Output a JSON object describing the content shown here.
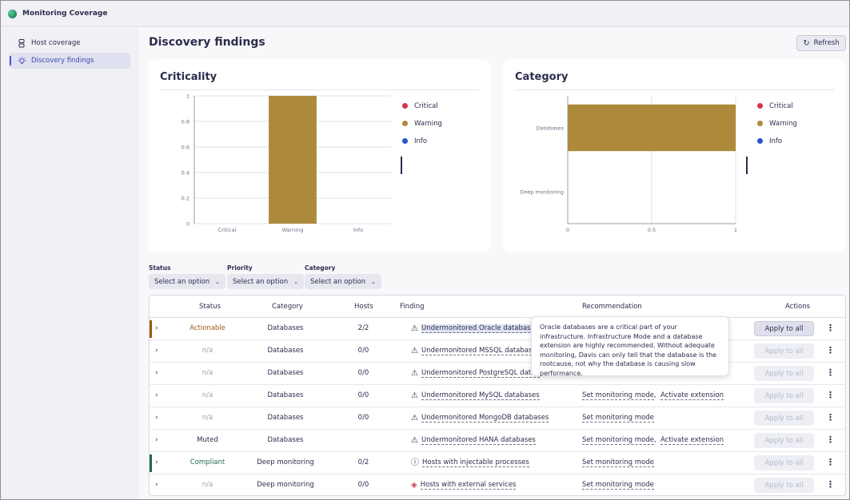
{
  "app": {
    "title": "Monitoring Coverage"
  },
  "sidebar": {
    "items": [
      {
        "label": "Host coverage",
        "icon": "server-icon"
      },
      {
        "label": "Discovery findings",
        "icon": "lightbulb-icon"
      }
    ]
  },
  "page": {
    "title": "Discovery findings",
    "refresh_label": "Refresh"
  },
  "colors": {
    "critical": "#d6324a",
    "warning": "#ad8a3b",
    "info": "#2c55c8",
    "accent": "#4556d4"
  },
  "criticality_card": {
    "title": "Criticality",
    "legend": [
      "Critical",
      "Warning",
      "Info"
    ]
  },
  "category_card": {
    "title": "Category",
    "legend": [
      "Critical",
      "Warning",
      "Info"
    ]
  },
  "chart_data": [
    {
      "type": "bar",
      "title": "Criticality",
      "categories": [
        "Critical",
        "Warning",
        "Info"
      ],
      "values": [
        0,
        1,
        0
      ],
      "ylim": [
        0,
        1
      ],
      "yticks": [
        "0",
        "0.2",
        "0.4",
        "0.6",
        "0.8",
        "1"
      ],
      "legend": [
        "Critical",
        "Warning",
        "Info"
      ],
      "legend_position": "right"
    },
    {
      "type": "bar",
      "orientation": "horizontal",
      "title": "Category",
      "categories": [
        "Databases",
        "Deep monitoring"
      ],
      "values": [
        1,
        0
      ],
      "xlim": [
        0,
        1
      ],
      "xticks": [
        "0",
        "0.5",
        "1"
      ],
      "legend": [
        "Critical",
        "Warning",
        "Info"
      ],
      "legend_position": "right"
    }
  ],
  "filters": [
    {
      "label": "Status",
      "value": "Select an option"
    },
    {
      "label": "Priority",
      "value": "Select an option"
    },
    {
      "label": "Category",
      "value": "Select an option"
    }
  ],
  "table": {
    "headers": {
      "status": "Status",
      "category": "Category",
      "hosts": "Hosts",
      "finding": "Finding",
      "recommendation": "Recommendation",
      "actions": "Actions"
    },
    "apply_label": "Apply to all",
    "rows": [
      {
        "status": "Actionable",
        "category": "Databases",
        "hosts": "2/2",
        "finding": "Undermonitored Oracle databases",
        "rec1": "",
        "rec2": ""
      },
      {
        "status": "n/a",
        "category": "Databases",
        "hosts": "0/0",
        "finding": "Undermonitored MSSQL databases",
        "rec1": "",
        "rec2": ""
      },
      {
        "status": "n/a",
        "category": "Databases",
        "hosts": "0/0",
        "finding": "Undermonitored PostgreSQL datab",
        "rec1": "",
        "rec2": ""
      },
      {
        "status": "n/a",
        "category": "Databases",
        "hosts": "0/0",
        "finding": "Undermonitored MySQL databases",
        "rec1": "Set monitoring mode",
        "rec2": "Activate extension"
      },
      {
        "status": "n/a",
        "category": "Databases",
        "hosts": "0/0",
        "finding": "Undermonitored MongoDB databases",
        "rec1": "Set monitoring mode",
        "rec2": ""
      },
      {
        "status": "Muted",
        "category": "Databases",
        "hosts": "",
        "finding": "Undermonitored HANA databases",
        "rec1": "Set monitoring mode",
        "rec2": "Activate extension"
      },
      {
        "status": "Compliant",
        "category": "Deep monitoring",
        "hosts": "0/2",
        "finding": "Hosts with injectable processes",
        "rec1": "Set monitoring mode",
        "rec2": ""
      },
      {
        "status": "n/a",
        "category": "Deep monitoring",
        "hosts": "0/0",
        "finding": "Hosts with external services",
        "rec1": "Set monitoring mode",
        "rec2": ""
      }
    ]
  },
  "tooltip": {
    "text": "Oracle databases are a critical part of your infrastructure. Infrastructure Mode and a database extension are highly recommended. Without adequate monitoring, Davis can only tell that the database is the rootcause, not why the database is causing slow performance."
  }
}
